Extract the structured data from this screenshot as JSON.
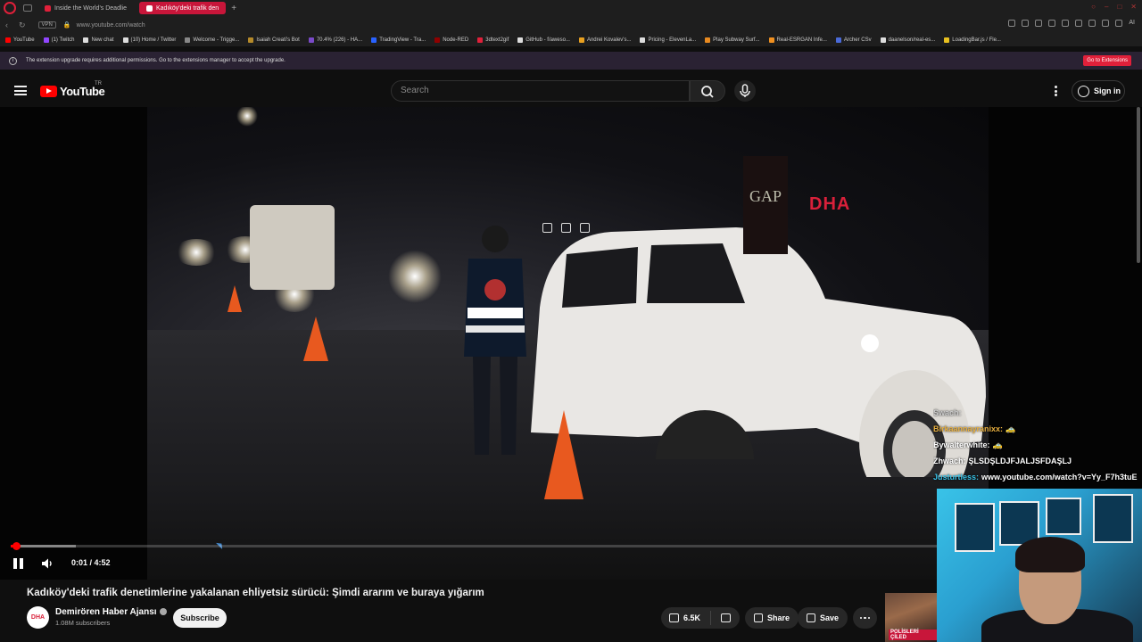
{
  "browser": {
    "tabs": [
      {
        "label": "Inside the World's Deadlie",
        "active": false
      },
      {
        "label": "Kadıköy'deki trafik den",
        "active": true
      }
    ],
    "new_tab": "+",
    "url": "www.youtube.com/watch",
    "vpn": "VPN",
    "ai_label": "AI",
    "bookmarks": [
      {
        "label": "YouTube",
        "color": "#ff0000"
      },
      {
        "label": "(1) Twitch",
        "color": "#9146ff"
      },
      {
        "label": "New chat",
        "color": "#dddddd"
      },
      {
        "label": "(10) Home / Twitter",
        "color": "#dddddd"
      },
      {
        "label": "Welcome - Trigge...",
        "color": "#888888"
      },
      {
        "label": "Isaiah Creati's Bot",
        "color": "#b58a2a"
      },
      {
        "label": "70.4% (226) - HA...",
        "color": "#7a4ac8"
      },
      {
        "label": "TradingView - Tra...",
        "color": "#2962ff"
      },
      {
        "label": "Node-RED",
        "color": "#8f0000"
      },
      {
        "label": "3dtext2gif",
        "color": "#e0203a"
      },
      {
        "label": "GitHub - f/aweso...",
        "color": "#dddddd"
      },
      {
        "label": "Andrei Kovalev's...",
        "color": "#e8a020"
      },
      {
        "label": "Pricing - ElevenLa...",
        "color": "#dddddd"
      },
      {
        "label": "Play Subway Surf...",
        "color": "#e88a20"
      },
      {
        "label": "Real-ESRGAN Infe...",
        "color": "#f09020"
      },
      {
        "label": "Archer CSv",
        "color": "#4a6ad8"
      },
      {
        "label": "daanelson/real-es...",
        "color": "#dddddd"
      },
      {
        "label": "LoadingBar.js / Fle...",
        "color": "#e8c020"
      }
    ]
  },
  "extension_notice": {
    "message": "The extension upgrade requires additional permissions. Go to the extensions manager to accept the upgrade.",
    "button": "Go to Extensions"
  },
  "youtube": {
    "logo_text": "YouTube",
    "country_code": "TR",
    "search_placeholder": "Search",
    "sign_in": "Sign in"
  },
  "player": {
    "current_time": "0:01",
    "duration": "4:52",
    "time_display": "0:01 / 4:52",
    "progress_fraction": 0.0034,
    "buffered_fraction": 0.058,
    "watermark": "DHA",
    "sign_text": "GAP"
  },
  "chat": [
    {
      "user": "Swach:",
      "message": "",
      "color": "#cccccc"
    },
    {
      "user": "Birkaannayranixx:",
      "message": "",
      "color": "#e8b040",
      "emote": "🚕"
    },
    {
      "user": "Bywalterwhite:",
      "message": "",
      "color": "#ffffff",
      "emote": "🚕"
    },
    {
      "user": "Zhwach:",
      "message": "ŞLSDŞLDJFJALJSFDAŞLJ",
      "color": "#ffffff"
    },
    {
      "user": "Justurtless:",
      "message": "www.youtube.com/watch?v=Yy_F7h3tuE",
      "color": "#39c3e8"
    }
  ],
  "video": {
    "title": "Kadıköy'deki trafik denetimlerine yakalanan ehliyetsiz sürücü: Şimdi ararım ve buraya yığarım",
    "channel": "Demirören Haber Ajansı",
    "channel_avatar_text": "DHA",
    "subscribers": "1.08M subscribers",
    "subscribe_label": "Subscribe",
    "likes": "6.5K",
    "share_label": "Share",
    "save_label": "Save",
    "next_thumb_text": "POLİSLERİ ÇİLED"
  }
}
